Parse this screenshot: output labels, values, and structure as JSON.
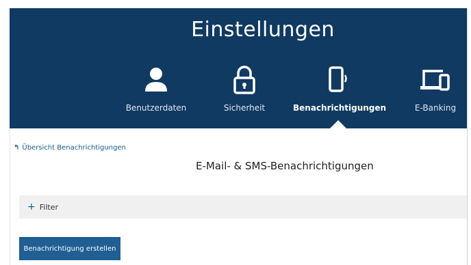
{
  "header": {
    "title": "Einstellungen",
    "nav": [
      {
        "label": "Benutzerdaten",
        "icon": "user-icon"
      },
      {
        "label": "Sicherheit",
        "icon": "lock-icon"
      },
      {
        "label": "Benachrichtigungen",
        "icon": "mobile-notification-icon",
        "active": true
      },
      {
        "label": "E-Banking",
        "icon": "devices-icon"
      }
    ]
  },
  "back_link": {
    "label": "Übersicht Benachrichtigungen"
  },
  "page_title": "E-Mail- & SMS-Benachrichtigungen",
  "filter": {
    "label": "Filter"
  },
  "create_button": {
    "label": "Benachrichtigung erstellen"
  },
  "colors": {
    "header_bg": "#103a62",
    "accent": "#1f5f93"
  }
}
